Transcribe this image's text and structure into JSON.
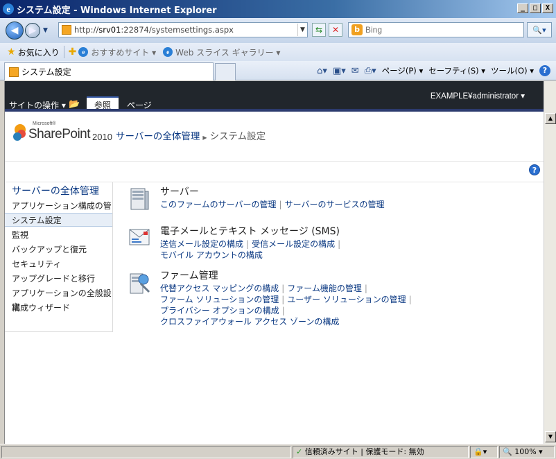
{
  "window": {
    "title": "システム設定 - Windows Internet Explorer",
    "btn_min": "_",
    "btn_max": "□",
    "btn_close": "X"
  },
  "address": {
    "url_prefix": "http://",
    "url_host": "srv01",
    "url_rest": ":22874/systemsettings.aspx",
    "search_placeholder": "Bing"
  },
  "favorites": {
    "label": "お気に入り",
    "items": [
      "おすすめサイト ▾",
      "Web スライス ギャラリー ▾"
    ]
  },
  "tab": {
    "title": "システム設定"
  },
  "commands": {
    "page": "ページ(P) ▾",
    "safety": "セーフティ(S) ▾",
    "tools": "ツール(O) ▾"
  },
  "ribbon": {
    "site_actions": "サイトの操作 ▾",
    "tab_browse": "参照",
    "tab_page": "ページ",
    "user": "EXAMPLE¥administrator ▾"
  },
  "header": {
    "logo_ms": "Microsoft®",
    "logo_product": "SharePoint",
    "logo_year": "2010",
    "crumb_root": "サーバーの全体管理",
    "crumb_current": "システム設定"
  },
  "leftnav": {
    "heading": "サーバーの全体管理",
    "items": [
      "アプリケーション構成の管理",
      "システム設定",
      "監視",
      "バックアップと復元",
      "セキュリティ",
      "アップグレードと移行",
      "アプリケーションの全般設定",
      "構成ウィザード"
    ]
  },
  "sections": {
    "servers": {
      "title": "サーバー",
      "links": [
        "このファームのサーバーの管理",
        "サーバーのサービスの管理"
      ]
    },
    "email": {
      "title": "電子メールとテキスト メッセージ (SMS)",
      "links": [
        "送信メール設定の構成",
        "受信メール設定の構成",
        "モバイル アカウントの構成"
      ]
    },
    "farm": {
      "title": "ファーム管理",
      "links": [
        "代替アクセス マッピングの構成",
        "ファーム機能の管理",
        "ファーム ソリューションの管理",
        "ユーザー ソリューションの管理",
        "プライバシー オプションの構成",
        "クロスファイアウォール アクセス ゾーンの構成"
      ]
    }
  },
  "status": {
    "zone": "信頼済みサイト | 保護モード: 無効",
    "zoom": "100%"
  }
}
